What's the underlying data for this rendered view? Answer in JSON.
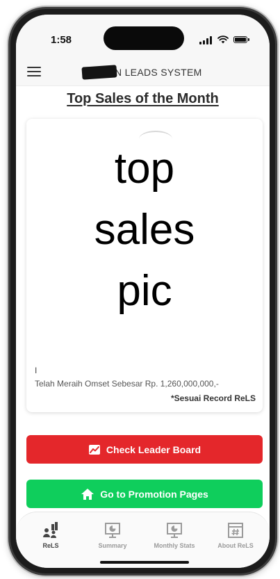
{
  "status_bar": {
    "time": "1:58"
  },
  "app_header": {
    "title": "N LEADS SYSTEM"
  },
  "page": {
    "title": "Top Sales of the Month"
  },
  "top_sales_card": {
    "picture_label": [
      "top",
      "sales",
      "pic"
    ],
    "name": "I",
    "omset_text": "Telah Meraih Omset Sebesar Rp. 1,260,000,000,-",
    "record_note": "*Sesuai Record ReLS"
  },
  "buttons": {
    "leader_board": "Check Leader Board",
    "promotion": "Go to Promotion Pages"
  },
  "bottom_nav": {
    "items": [
      {
        "label": "ReLS",
        "icon": "people-chart-icon",
        "active": true
      },
      {
        "label": "Summary",
        "icon": "presentation-icon",
        "active": false
      },
      {
        "label": "Monthly Stats",
        "icon": "presentation-icon",
        "active": false
      },
      {
        "label": "About ReLS",
        "icon": "hashtag-window-icon",
        "active": false
      }
    ]
  },
  "colors": {
    "leader_board_button": "#e4272b",
    "promotion_button": "#0fce5c"
  }
}
